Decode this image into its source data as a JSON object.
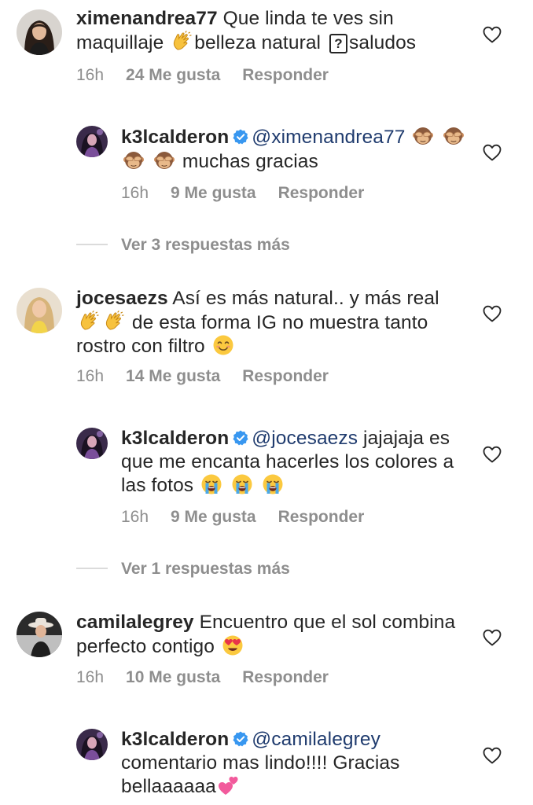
{
  "comments": [
    {
      "username": "ximenandrea77",
      "text_parts": [
        "Que linda te ves sin maquillaje",
        "belleza natural",
        "saludos"
      ],
      "time": "16h",
      "likes": "24 Me gusta",
      "reply_label": "Responder"
    },
    {
      "username": "k3lcalderon",
      "mention": "@ximenandrea77",
      "text_parts": [
        "muchas gracias"
      ],
      "time": "16h",
      "likes": "9 Me gusta",
      "reply_label": "Responder"
    },
    {
      "view_more": "Ver 3 respuestas más"
    },
    {
      "username": "jocesaezs",
      "text_parts": [
        "Así es más natural.. y más real",
        "de esta forma IG no muestra tanto rostro con filtro"
      ],
      "time": "16h",
      "likes": "14 Me gusta",
      "reply_label": "Responder"
    },
    {
      "username": "k3lcalderon",
      "mention": "@jocesaezs",
      "text_parts": [
        "jajajaja es que me encanta hacerles los colores a las fotos"
      ],
      "time": "16h",
      "likes": "9 Me gusta",
      "reply_label": "Responder"
    },
    {
      "view_more": "Ver 1 respuestas más"
    },
    {
      "username": "camilalegrey",
      "text_parts": [
        "Encuentro que el sol combina perfecto contigo"
      ],
      "time": "16h",
      "likes": "10 Me gusta",
      "reply_label": "Responder"
    },
    {
      "username": "k3lcalderon",
      "mention": "@camilalegrey",
      "text_parts": [
        "comentario mas lindo!!!! Gracias bellaaaaaa"
      ]
    }
  ],
  "icons": {
    "like": "heart-outline-icon",
    "verified": "verified-badge-icon",
    "unknown_glyph": "?"
  },
  "colors": {
    "text": "#262626",
    "muted": "#8e8e8e",
    "mention": "#1f3b6e",
    "verified": "#3897f0"
  }
}
